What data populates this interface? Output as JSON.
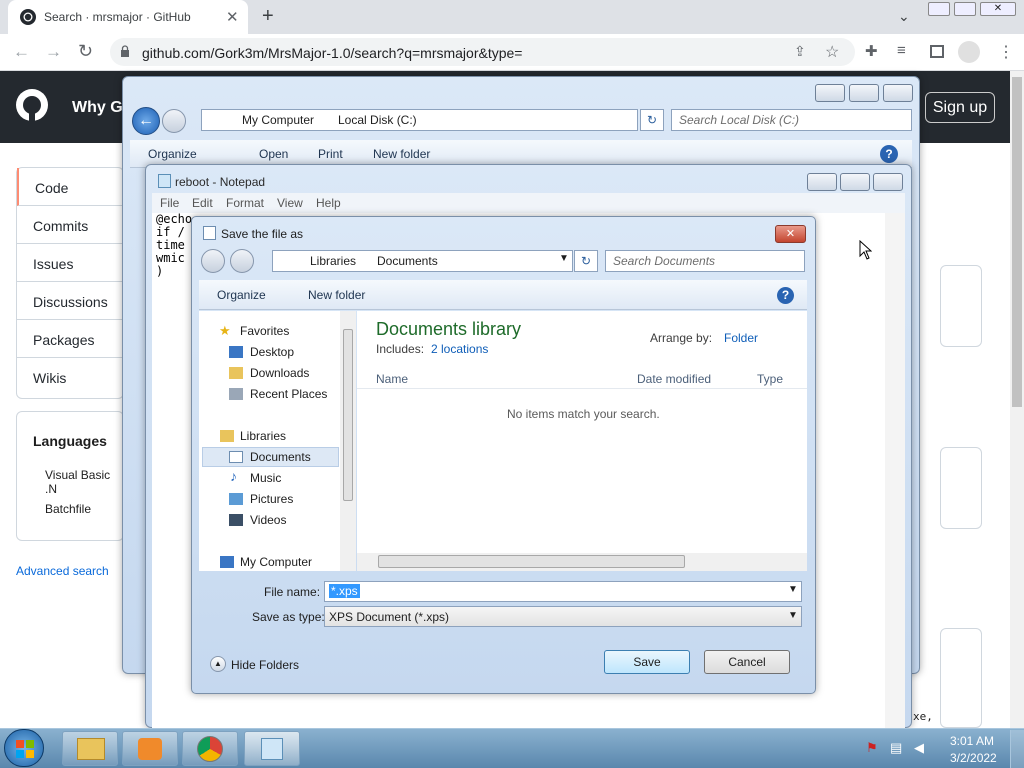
{
  "browser": {
    "tab_title": "Search · mrsmajor · GitHub",
    "url": "github.com/Gork3m/MrsMajor-1.0/search?q=mrsmajor&type="
  },
  "github": {
    "why_label": "Why Gi",
    "signup_label": "Sign up",
    "nav": [
      "Code",
      "Commits",
      "Issues",
      "Discussions",
      "Packages",
      "Wikis"
    ],
    "languages_title": "Languages",
    "languages": [
      "Visual Basic .N",
      "Batchfile"
    ],
    "advanced_search": "Advanced search",
    "code_snippet": "xe,"
  },
  "explorer": {
    "breadcrumb": [
      "My Computer",
      "Local Disk (C:)"
    ],
    "search_placeholder": "Search Local Disk (C:)",
    "commands": [
      "Organize",
      "Open",
      "Print",
      "New folder"
    ]
  },
  "notepad": {
    "title": "reboot - Notepad",
    "menu": [
      "File",
      "Edit",
      "Format",
      "View",
      "Help"
    ],
    "lines": [
      "@echo",
      "if /",
      "time",
      "wmic",
      ")"
    ]
  },
  "dialog": {
    "title": "Save the file as",
    "breadcrumb": [
      "Libraries",
      "Documents"
    ],
    "search_placeholder": "Search Documents",
    "organize_label": "Organize",
    "new_folder_label": "New folder",
    "tree": {
      "favorites_label": "Favorites",
      "favorites": [
        "Desktop",
        "Downloads",
        "Recent Places"
      ],
      "libraries_label": "Libraries",
      "libraries": [
        "Documents",
        "Music",
        "Pictures",
        "Videos"
      ],
      "computer_label": "My Computer"
    },
    "library_title": "Documents library",
    "includes_label": "Includes:",
    "includes_link": "2 locations",
    "arrange_label": "Arrange by:",
    "arrange_value": "Folder",
    "columns": [
      "Name",
      "Date modified",
      "Type"
    ],
    "empty_message": "No items match your search.",
    "file_name_label": "File name:",
    "file_name_value": "*.xps",
    "save_type_label": "Save as type:",
    "save_type_value": "XPS Document (*.xps)",
    "hide_folders_label": "Hide Folders",
    "save_label": "Save",
    "cancel_label": "Cancel"
  },
  "taskbar": {
    "time": "3:01 AM",
    "date": "3/2/2022"
  }
}
